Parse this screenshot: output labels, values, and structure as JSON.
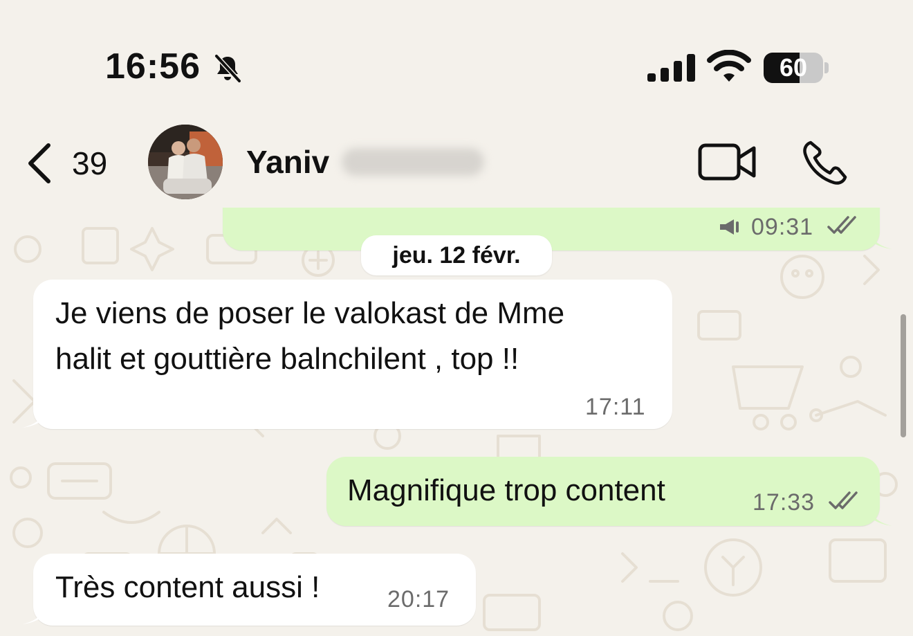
{
  "status_bar": {
    "time": "16:56",
    "mute_icon": "bell-slash-icon",
    "signal_icon": "cellular-signal-icon",
    "wifi_icon": "wifi-icon",
    "battery_level": "60",
    "battery_fraction": 0.6
  },
  "header": {
    "back_icon": "chevron-left-icon",
    "unread_count": "39",
    "contact_name": "Yaniv",
    "video_icon": "video-camera-icon",
    "call_icon": "phone-icon"
  },
  "chat": {
    "previous_message": {
      "time": "09:31",
      "icon": "megaphone-icon",
      "status_icon": "double-check-icon"
    },
    "date_separator": "jeu. 12 févr.",
    "messages": [
      {
        "direction": "incoming",
        "lines": [
          "Je viens de poser le valokast de Mme",
          "halit et gouttière balnchilent , top !!"
        ],
        "time": "17:11"
      },
      {
        "direction": "outgoing",
        "text": "Magnifique trop content",
        "time": "17:33",
        "status_icon": "double-check-icon"
      },
      {
        "direction": "incoming",
        "text": "Très content aussi !",
        "time": "20:17"
      }
    ]
  },
  "colors": {
    "background": "#f4f1eb",
    "incoming_bubble": "#ffffff",
    "outgoing_bubble": "#dcf8c6",
    "timestamp": "#6b6b6b"
  }
}
